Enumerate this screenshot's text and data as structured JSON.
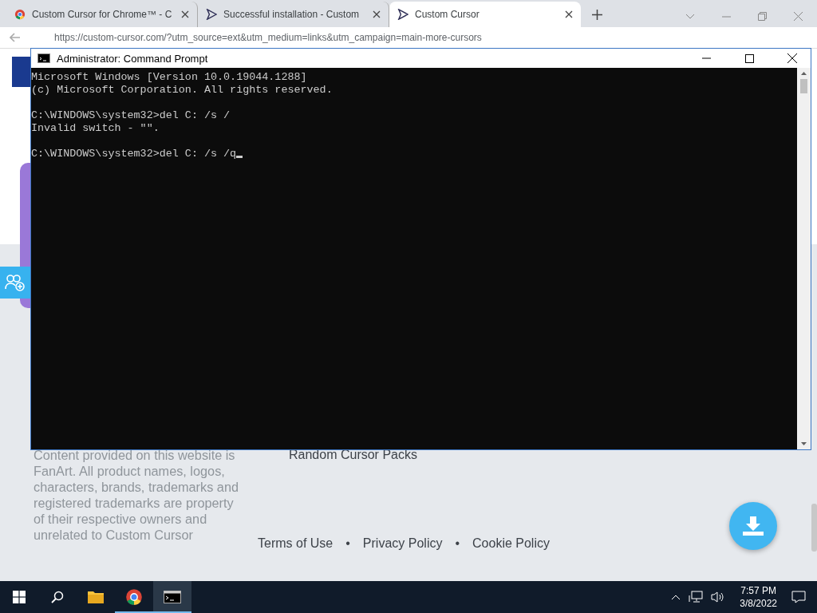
{
  "browser": {
    "tabs": [
      {
        "title": "Custom Cursor for Chrome™ - C",
        "kind": "chrome",
        "selected": false
      },
      {
        "title": "Successful installation - Custom",
        "kind": "cursor",
        "selected": false
      },
      {
        "title": "Custom Cursor",
        "kind": "cursor",
        "selected": true
      }
    ],
    "url": "https://custom-cursor.com/?utm_source=ext&utm_medium=links&utm_campaign=main-more-cursors"
  },
  "page": {
    "footer_note": "Content provided on this website is FanArt. All product names, logos, characters, brands, trademarks and registered trademarks are property of their respective owners and unrelated to Custom Cursor",
    "footer_link": "Random Cursor Packs",
    "legal_links": [
      "Terms of Use",
      "Privacy Policy",
      "Cookie Policy"
    ],
    "separator": "•"
  },
  "console_window": {
    "title": "Administrator: Command Prompt",
    "blocks": [
      [
        "Microsoft Windows [Version 10.0.19044.1288]",
        "(c) Microsoft Corporation. All rights reserved."
      ],
      [
        "C:\\WINDOWS\\system32>del C: /s /",
        "Invalid switch - \"\"."
      ],
      [
        "C:\\WINDOWS\\system32>del C: /s /q"
      ]
    ],
    "cursor": true
  },
  "taskbar": {
    "apps": [
      {
        "kind": "explorer",
        "open": false,
        "selected": false
      },
      {
        "kind": "chrome",
        "open": true,
        "selected": false
      },
      {
        "kind": "terminal",
        "open": true,
        "selected": true
      }
    ],
    "time": "7:57 PM",
    "date": "3/8/2022"
  }
}
